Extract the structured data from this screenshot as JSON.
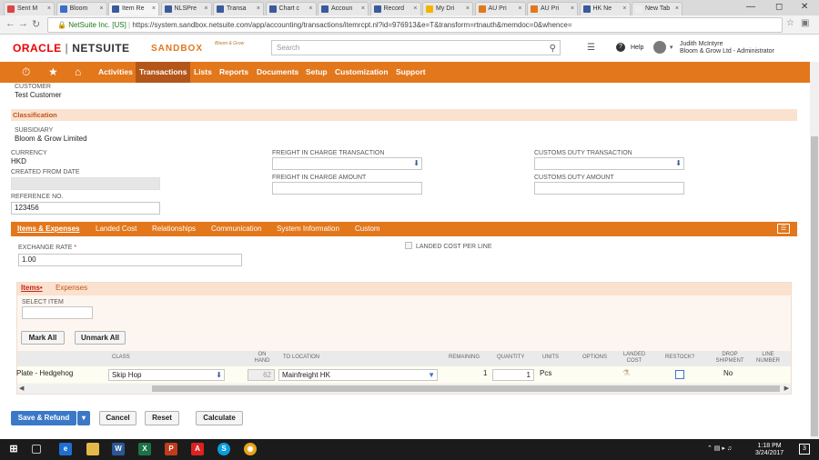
{
  "browser": {
    "tabs": [
      {
        "label": "Sent M",
        "color": "#d44"
      },
      {
        "label": "Bloom",
        "color": "#3b6dc7"
      },
      {
        "label": "Item Re",
        "color": "#3b5a9a",
        "active": true
      },
      {
        "label": "NLSPre",
        "color": "#3b5a9a"
      },
      {
        "label": "Transa",
        "color": "#3b5a9a"
      },
      {
        "label": "Chart c",
        "color": "#3b5a9a"
      },
      {
        "label": "Accoun",
        "color": "#3b5a9a"
      },
      {
        "label": "Record",
        "color": "#3b5a9a"
      },
      {
        "label": "My Dri",
        "color": "#f4b400"
      },
      {
        "label": "AU Pri",
        "color": "#e2771c"
      },
      {
        "label": "AU Pri",
        "color": "#e2771c"
      },
      {
        "label": "HK Ne",
        "color": "#3b5a9a"
      },
      {
        "label": "New Tab",
        "color": "#eee"
      }
    ],
    "secure_label": "NetSuite Inc. [US]",
    "url": "https://system.sandbox.netsuite.com/app/accounting/transactions/itemrcpt.nl?id=976913&e=T&transform=rtnauth&memdoc=0&whence="
  },
  "header": {
    "oracle": "ORACLE",
    "netsuite": "NETSUITE",
    "sandbox": "SANDBOX",
    "brand_text": "Bloom & Grow",
    "search_placeholder": "Search",
    "help_label": "Help",
    "user_name": "Judith McIntyre",
    "user_role": "Bloom & Grow Ltd - Administrator"
  },
  "menu": {
    "items": [
      "Activities",
      "Transactions",
      "Lists",
      "Reports",
      "Documents",
      "Setup",
      "Customization",
      "Support"
    ]
  },
  "form": {
    "customer_label": "CUSTOMER",
    "customer_value": "Test Customer",
    "classification_heading": "Classification",
    "subsidiary_label": "SUBSIDIARY",
    "subsidiary_value": "Bloom & Grow Limited",
    "currency_label": "CURRENCY",
    "currency_value": "HKD",
    "created_from_label": "CREATED FROM DATE",
    "reference_label": "REFERENCE NO.",
    "reference_value": "123456",
    "freight_txn_label": "FREIGHT IN CHARGE TRANSACTION",
    "freight_amt_label": "FREIGHT IN CHARGE AMOUNT",
    "customs_txn_label": "CUSTOMS DUTY TRANSACTION",
    "customs_amt_label": "CUSTOMS DUTY AMOUNT"
  },
  "subtabs": [
    "Items & Expenses",
    "Landed Cost",
    "Relationships",
    "Communication",
    "System Information",
    "Custom"
  ],
  "items_section": {
    "exchange_rate_label": "EXCHANGE RATE",
    "required_mark": "*",
    "exchange_rate_value": "1.00",
    "landed_cost_per_line_label": "LANDED COST PER LINE",
    "tabs": [
      "Items",
      "Expenses"
    ],
    "items_tab_marker": "•",
    "select_item_label": "SELECT ITEM",
    "mark_all": "Mark All",
    "unmark_all": "Unmark All",
    "columns": {
      "class": "CLASS",
      "on_hand": "ON HAND",
      "to_location": "TO LOCATION",
      "remaining": "REMAINING",
      "quantity": "QUANTITY",
      "units": "UNITS",
      "options": "OPTIONS",
      "landed_cost": "LANDED COST",
      "restock": "RESTOCK?",
      "drop_shipment": "DROP SHIPMENT",
      "line_number": "LINE NUMBER"
    },
    "rows": [
      {
        "item": "Plate - Hedgehog",
        "class": "Skip Hop",
        "on_hand": "62",
        "to_location": "Mainfreight HK",
        "remaining": "1",
        "quantity": "1",
        "units": "Pcs",
        "drop_shipment": "No"
      }
    ]
  },
  "actions": {
    "save_refund": "Save & Refund",
    "cancel": "Cancel",
    "reset": "Reset",
    "calculate": "Calculate"
  },
  "taskbar": {
    "time": "1:18 PM",
    "date": "3/24/2017",
    "notification_count": "3"
  }
}
